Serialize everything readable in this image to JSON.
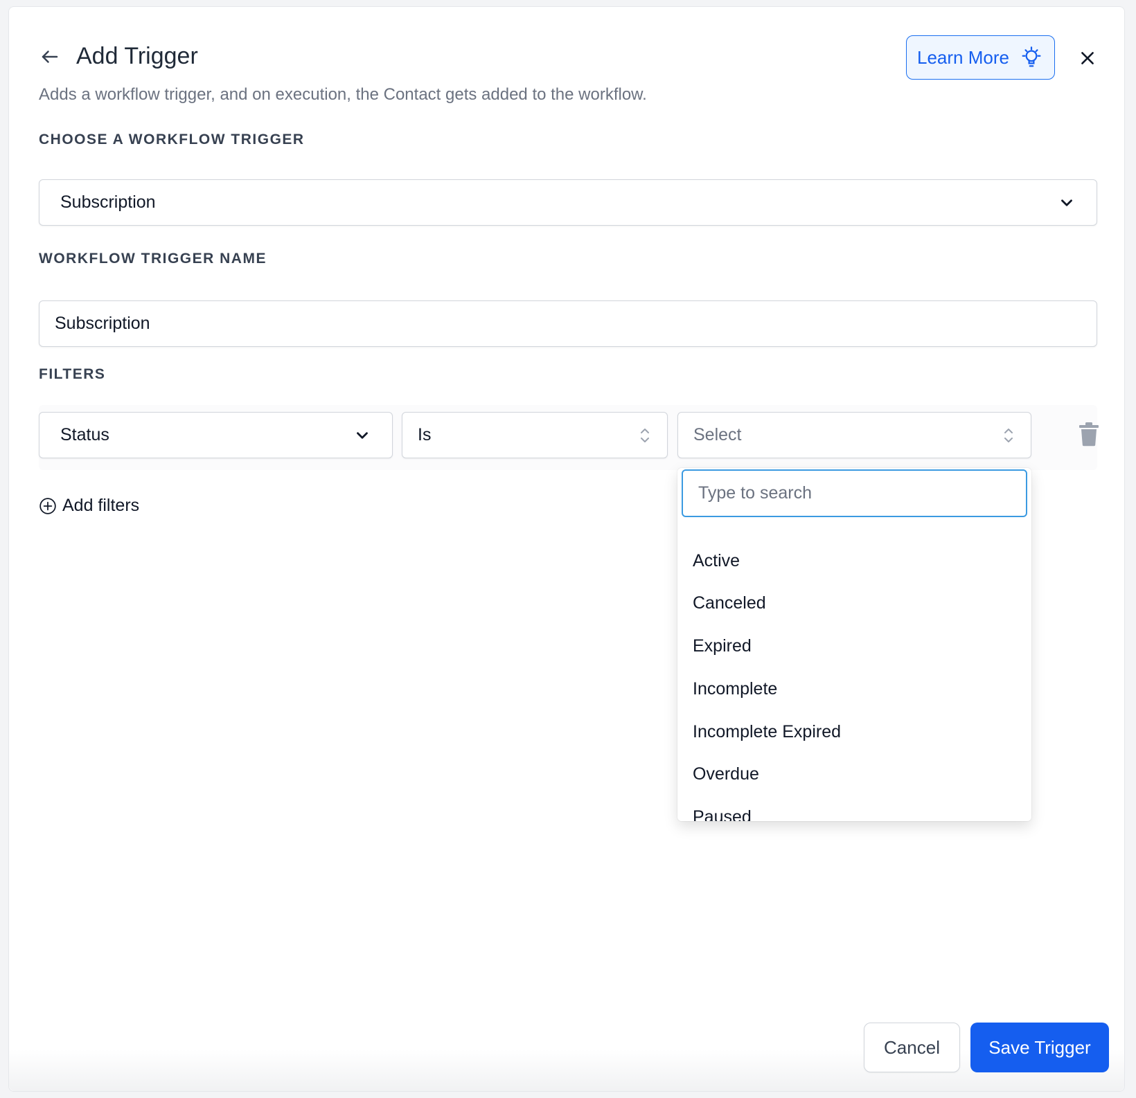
{
  "header": {
    "title": "Add Trigger",
    "subtitle": "Adds a workflow trigger, and on execution, the Contact gets added to the workflow.",
    "learn_more_label": "Learn More"
  },
  "trigger_section": {
    "label": "CHOOSE A WORKFLOW TRIGGER",
    "selected_value": "Subscription"
  },
  "name_section": {
    "label": "WORKFLOW TRIGGER NAME",
    "value": "Subscription"
  },
  "filters_section": {
    "label": "FILTERS",
    "field_value": "Status",
    "operator_value": "Is",
    "value_placeholder": "Select",
    "add_filters_label": "Add filters"
  },
  "dropdown": {
    "search_placeholder": "Type to search",
    "options": [
      "Active",
      "Canceled",
      "Expired",
      "Incomplete",
      "Incomplete Expired",
      "Overdue",
      "Paused"
    ]
  },
  "footer": {
    "cancel_label": "Cancel",
    "save_label": "Save Trigger"
  },
  "colors": {
    "primary": "#155eef",
    "focus_border": "#3b9ae1",
    "text": "#111827",
    "muted": "#6b7280"
  }
}
